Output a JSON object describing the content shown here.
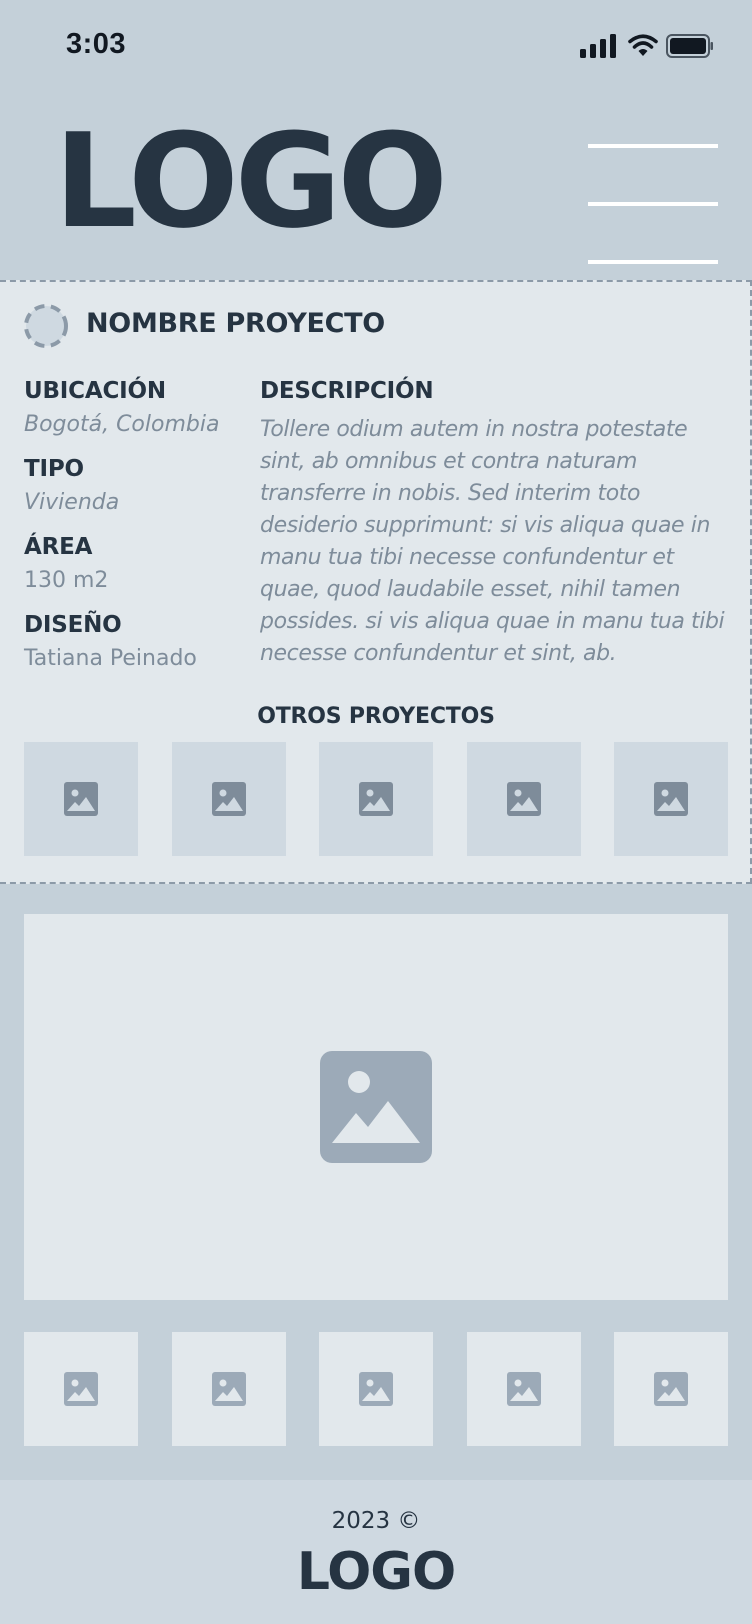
{
  "status": {
    "time": "3:03"
  },
  "header": {
    "logo": "LOGO"
  },
  "project": {
    "name": "NOMBRE PROYECTO",
    "info": [
      {
        "label": "UBICACIÓN",
        "value": "Bogotá, Colombia"
      },
      {
        "label": "TIPO",
        "value": "Vivienda"
      },
      {
        "label": "ÁREA",
        "value": "130 m2"
      },
      {
        "label": "DISEÑO",
        "value": "Tatiana Peinado"
      }
    ],
    "description_label": "DESCRIPCIÓN",
    "description": "Tollere odium autem in nostra potestate sint, ab omnibus et contra naturam transferre in nobis. Sed interim toto desiderio supprimunt: si vis aliqua quae in manu tua tibi necesse confundentur et quae, quod laudabile esset, nihil tamen possides. si vis aliqua quae in manu tua tibi necesse confundentur et sint, ab.",
    "others_title": "OTROS PROYECTOS"
  },
  "icons": {
    "image": "image-placeholder-icon",
    "menu": "hamburger-menu-icon",
    "spinner": "loading-spinner-icon"
  },
  "colors": {
    "background": "#c4d0d9",
    "card": "#e2e8ec",
    "text_dark": "#263442",
    "text_muted": "#7e8c9a"
  },
  "footer": {
    "copyright": "2023 ©",
    "logo": "LOGO"
  }
}
